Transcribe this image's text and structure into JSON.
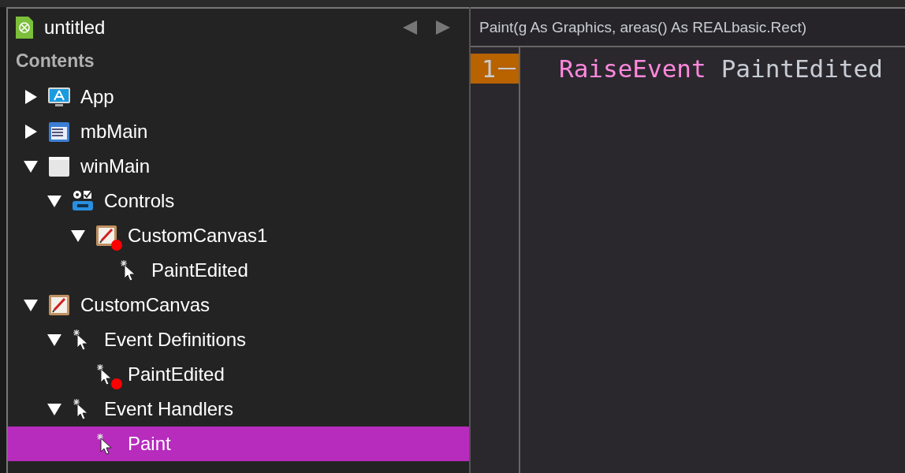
{
  "project": {
    "title": "untitled",
    "back_enabled": false,
    "forward_enabled": false
  },
  "navigator": {
    "heading": "Contents",
    "items": [
      {
        "label": "App",
        "kind": "app",
        "expanded": false,
        "selected": false,
        "modified": false
      },
      {
        "label": "mbMain",
        "kind": "menubar",
        "expanded": false,
        "selected": false,
        "modified": false
      },
      {
        "label": "winMain",
        "kind": "window",
        "expanded": true,
        "selected": false,
        "modified": false,
        "children": [
          {
            "label": "Controls",
            "kind": "controls",
            "expanded": true,
            "selected": false,
            "modified": false,
            "children": [
              {
                "label": "CustomCanvas1",
                "kind": "canvas",
                "expanded": true,
                "selected": false,
                "modified": true,
                "children": [
                  {
                    "label": "PaintEdited",
                    "kind": "event",
                    "selected": false,
                    "modified": false
                  }
                ]
              }
            ]
          }
        ]
      },
      {
        "label": "CustomCanvas",
        "kind": "canvas",
        "expanded": true,
        "selected": false,
        "modified": false,
        "children": [
          {
            "label": "Event Definitions",
            "kind": "event",
            "expanded": true,
            "selected": false,
            "modified": false,
            "children": [
              {
                "label": "PaintEdited",
                "kind": "event",
                "selected": false,
                "modified": true
              }
            ]
          },
          {
            "label": "Event Handlers",
            "kind": "event",
            "expanded": true,
            "selected": false,
            "modified": false,
            "children": [
              {
                "label": "Paint",
                "kind": "event",
                "selected": true,
                "modified": false
              }
            ]
          }
        ]
      }
    ]
  },
  "editor": {
    "signature": "Paint(g As Graphics, areas() As REALbasic.Rect)",
    "lines": [
      {
        "number": "1",
        "current": true,
        "tokens": [
          {
            "text": "RaiseEvent",
            "kind": "keyword"
          },
          {
            "text": "PaintEdited",
            "kind": "identifier"
          }
        ]
      }
    ]
  }
}
